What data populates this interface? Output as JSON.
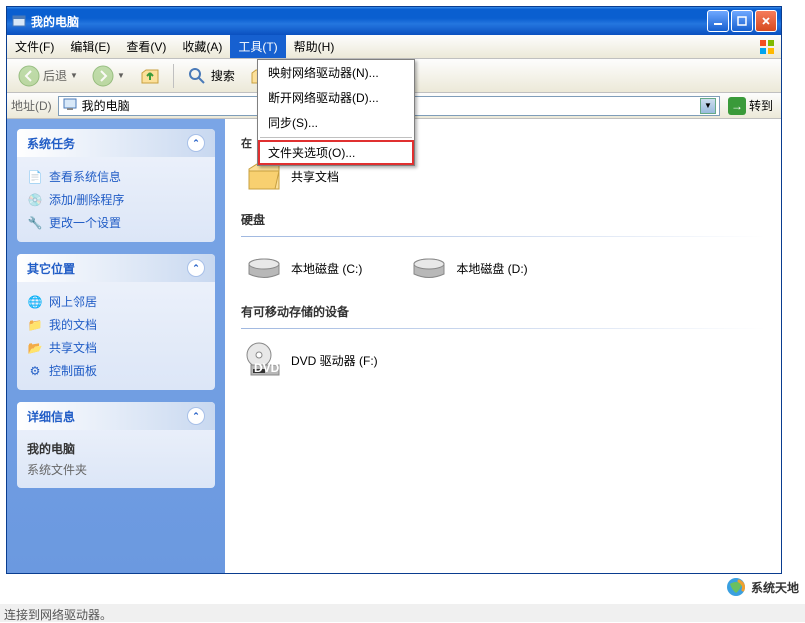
{
  "window": {
    "title": "我的电脑"
  },
  "menubar": {
    "items": [
      "文件(F)",
      "编辑(E)",
      "查看(V)",
      "收藏(A)",
      "工具(T)",
      "帮助(H)"
    ],
    "active_index": 4
  },
  "dropdown": {
    "items": [
      "映射网络驱动器(N)...",
      "断开网络驱动器(D)...",
      "同步(S)..."
    ],
    "highlighted": "文件夹选项(O)..."
  },
  "toolbar": {
    "back": "后退",
    "search": "搜索",
    "folders_partial": "文"
  },
  "addressbar": {
    "label": "地址(D)",
    "value": "我的电脑",
    "go": "转到"
  },
  "sidebar": {
    "panels": [
      {
        "title": "系统任务",
        "tasks": [
          "查看系统信息",
          "添加/删除程序",
          "更改一个设置"
        ]
      },
      {
        "title": "其它位置",
        "tasks": [
          "网上邻居",
          "我的文档",
          "共享文档",
          "控制面板"
        ]
      }
    ],
    "details": {
      "title": "详细信息",
      "name": "我的电脑",
      "type": "系统文件夹"
    }
  },
  "main": {
    "partial_header": "在",
    "sections": [
      {
        "title": "",
        "items": [
          {
            "label": "共享文档",
            "icon": "folder"
          }
        ]
      },
      {
        "title": "硬盘",
        "items": [
          {
            "label": "本地磁盘 (C:)",
            "icon": "hdd"
          },
          {
            "label": "本地磁盘 (D:)",
            "icon": "hdd"
          }
        ]
      },
      {
        "title": "有可移动存储的设备",
        "items": [
          {
            "label": "DVD 驱动器 (F:)",
            "icon": "dvd"
          }
        ]
      }
    ]
  },
  "statusbar": {
    "text": "连接到网络驱动器。"
  },
  "watermark": {
    "text": "系统天地"
  }
}
